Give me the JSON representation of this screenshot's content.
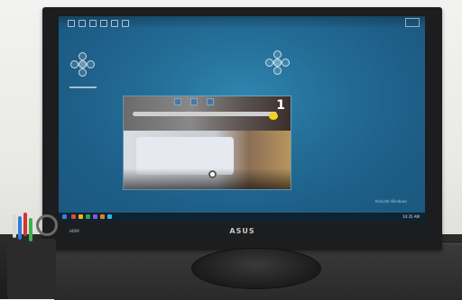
{
  "monitor": {
    "brand": "ASUS",
    "port_label": "HDMI",
    "screen": {
      "video_number": "1",
      "watermark": "Activate Windows",
      "tray_time": "10:35 AM"
    }
  }
}
